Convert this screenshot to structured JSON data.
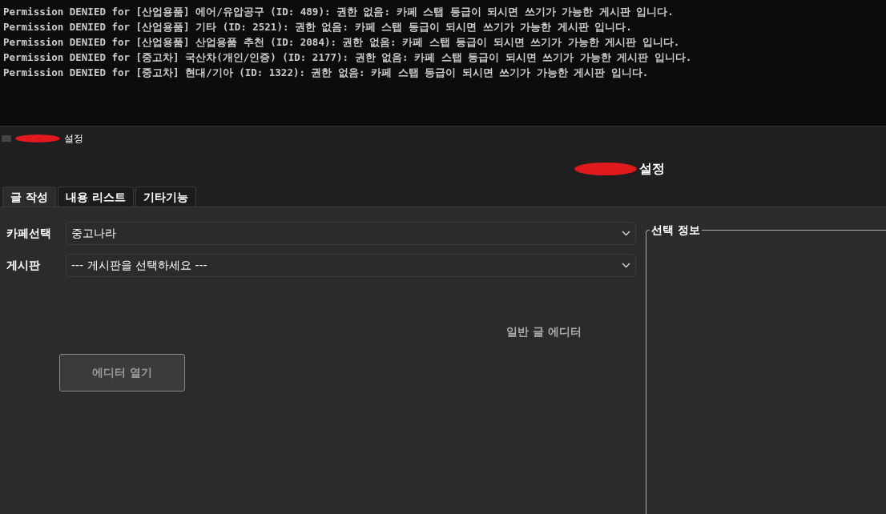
{
  "terminal": {
    "lines": [
      "Permission DENIED for [산업용품] 에어/유압공구 (ID: 489): 권한 없음: 카페 스탭 등급이 되시면 쓰기가 가능한 게시판 입니다.",
      "Permission DENIED for [산업용품] 기타 (ID: 2521): 권한 없음: 카페 스탭 등급이 되시면 쓰기가 가능한 게시판 입니다.",
      "Permission DENIED for [산업용품] 산업용품 추천 (ID: 2084): 권한 없음: 카페 스탭 등급이 되시면 쓰기가 가능한 게시판 입니다.",
      "Permission DENIED for [중고차] 국산차(개인/인증) (ID: 2177): 권한 없음: 카페 스탭 등급이 되시면 쓰기가 가능한 게시판 입니다.",
      "Permission DENIED for [중고차] 현대/기아 (ID: 1322): 권한 없음: 카페 스탭 등급이 되시면 쓰기가 가능한 게시판 입니다."
    ]
  },
  "window": {
    "title": "설정"
  },
  "heading": "설정",
  "tabs": [
    {
      "label": "글 작성",
      "selected": true
    },
    {
      "label": "내용 리스트",
      "selected": false
    },
    {
      "label": "기타기능",
      "selected": false
    }
  ],
  "form": {
    "fields": [
      {
        "label": "카페선택",
        "value": "중고나라"
      },
      {
        "label": "게시판",
        "value": "--- 게시판을 선택하세요 ---"
      }
    ],
    "editor_label": "일반 글 에디터",
    "editor_button": {
      "label": "에디터 열기",
      "disabled": true
    }
  },
  "info_group": {
    "title": "선택 정보"
  }
}
